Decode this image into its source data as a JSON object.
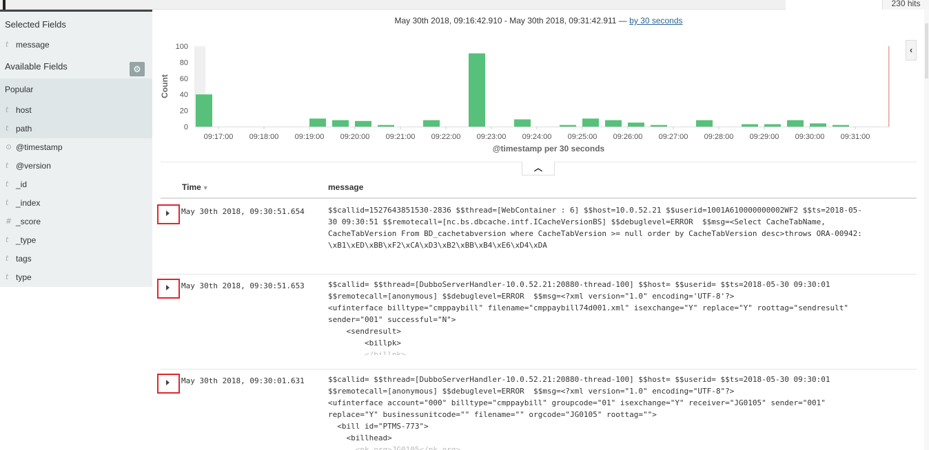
{
  "hits": "230 hits",
  "sidebar": {
    "selected_title": "Selected Fields",
    "selected_fields": [
      {
        "type": "t",
        "name": "message"
      }
    ],
    "available_title": "Available Fields",
    "popular_title": "Popular",
    "popular_fields": [
      {
        "type": "t",
        "name": "host"
      },
      {
        "type": "t",
        "name": "path"
      }
    ],
    "other_fields": [
      {
        "type": "⊙",
        "name": "@timestamp"
      },
      {
        "type": "t",
        "name": "@version"
      },
      {
        "type": "t",
        "name": "_id"
      },
      {
        "type": "t",
        "name": "_index"
      },
      {
        "type": "#",
        "name": "_score"
      },
      {
        "type": "t",
        "name": "_type"
      },
      {
        "type": "t",
        "name": "tags"
      },
      {
        "type": "t",
        "name": "type"
      }
    ]
  },
  "chart": {
    "range_text": "May 30th 2018, 09:16:42.910 - May 30th 2018, 09:31:42.911 — ",
    "interval_link": "by 30 seconds"
  },
  "chart_data": {
    "type": "bar",
    "ylabel": "Count",
    "xlabel": "@timestamp per 30 seconds",
    "ylim": [
      0,
      100
    ],
    "y_ticks": [
      0,
      20,
      40,
      60,
      80,
      100
    ],
    "x_ticks": [
      "09:17:00",
      "09:18:00",
      "09:19:00",
      "09:20:00",
      "09:21:00",
      "09:22:00",
      "09:23:00",
      "09:24:00",
      "09:25:00",
      "09:26:00",
      "09:27:00",
      "09:28:00",
      "09:29:00",
      "09:30:00",
      "09:31:00"
    ],
    "categories": [
      "09:16:30",
      "09:17:00",
      "09:17:30",
      "09:18:00",
      "09:18:30",
      "09:19:00",
      "09:19:30",
      "09:20:00",
      "09:20:30",
      "09:21:00",
      "09:21:30",
      "09:22:00",
      "09:22:30",
      "09:23:00",
      "09:23:30",
      "09:24:00",
      "09:24:30",
      "09:25:00",
      "09:25:30",
      "09:26:00",
      "09:26:30",
      "09:27:00",
      "09:27:30",
      "09:28:00",
      "09:28:30",
      "09:29:00",
      "09:29:30",
      "09:30:00",
      "09:30:30",
      "09:31:00",
      "09:31:30"
    ],
    "values": [
      40,
      0,
      0,
      0,
      0,
      10,
      8,
      7,
      2,
      0,
      8,
      0,
      91,
      0,
      9,
      0,
      2,
      10,
      8,
      5,
      2,
      0,
      8,
      0,
      3,
      3,
      8,
      4,
      2,
      0,
      0
    ],
    "bar_color": "#57c17b",
    "grid": false
  },
  "table": {
    "columns": {
      "time": "Time",
      "message": "message"
    },
    "rows": [
      {
        "time": "May 30th 2018, 09:30:51.654",
        "lines": [
          "$$callid=1527643851530-2836 $$thread=[WebContainer : 6] $$host=10.0.52.21 $$userid=1001A610000000002WF2 $$ts=2018-05-",
          "30 09:30:51 $$remotecall=[nc.bs.dbcache.intf.ICacheVersionBS] $$debuglevel=ERROR  $$msg=<Select CacheTabName,",
          "CacheTabVersion From BD_cachetabversion where CacheTabVersion >= null order by CacheTabVersion desc>throws ORA-00942:",
          "\\xB1\\xED\\xBB\\xF2\\xCA\\xD3\\xB2\\xBB\\xB4\\xE6\\xD4\\xDA"
        ],
        "faded_line": ""
      },
      {
        "time": "May 30th 2018, 09:30:51.653",
        "lines": [
          "$$callid= $$thread=[DubboServerHandler-10.0.52.21:20880-thread-100] $$host= $$userid= $$ts=2018-05-30 09:30:01",
          "$$remotecall=[anonymous] $$debuglevel=ERROR  $$msg=<?xml version=\"1.0\" encoding='UTF-8'?>",
          "<ufinterface billtype=\"cmppaybill\" filename=\"cmppaybill74d001.xml\" isexchange=\"Y\" replace=\"Y\" roottag=\"sendresult\"",
          "sender=\"001\" successful=\"N\">",
          "    <sendresult>",
          "        <billpk>"
        ],
        "faded_line": "        </billpk>"
      },
      {
        "time": "May 30th 2018, 09:30:01.631",
        "lines": [
          "$$callid= $$thread=[DubboServerHandler-10.0.52.21:20880-thread-100] $$host= $$userid= $$ts=2018-05-30 09:30:01",
          "$$remotecall=[anonymous] $$debuglevel=ERROR  $$msg=<?xml version=\"1.0\" encoding=\"UTF-8\"?>",
          "<ufinterface account=\"000\" billtype=\"cmppaybill\" groupcode=\"01\" isexchange=\"Y\" receiver=\"JG0105\" sender=\"001\"",
          "replace=\"Y\" businessunitcode=\"\" filename=\"\" orgcode=\"JG0105\" roottag=\"\">",
          "  <bill id=\"PTMS-773\">",
          "    <billhead>"
        ],
        "faded_line": "      <pk_org>JG0105</pk_org>"
      }
    ]
  }
}
